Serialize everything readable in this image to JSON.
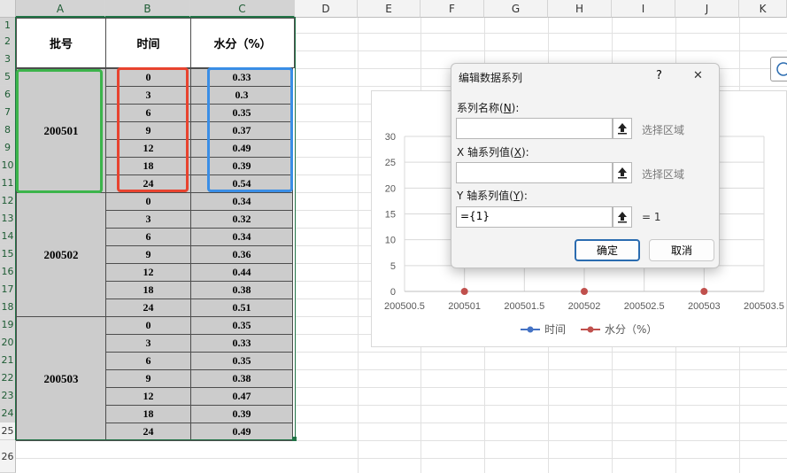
{
  "sheet": {
    "columns": [
      "A",
      "B",
      "C",
      "D",
      "E",
      "F",
      "G",
      "H",
      "I",
      "J",
      "K"
    ],
    "rows": [
      "1",
      "2",
      "3",
      "4",
      "5",
      "6",
      "7",
      "8",
      "9",
      "10",
      "11",
      "12",
      "13",
      "14",
      "15",
      "16",
      "17",
      "18",
      "19",
      "20",
      "21",
      "22",
      "23",
      "24",
      "25",
      "26"
    ]
  },
  "table": {
    "header": {
      "batch": "批号",
      "time": "时间",
      "moisture": "水分（%）"
    },
    "groups": [
      {
        "batch": "200501",
        "rows": [
          [
            "0",
            "0.33"
          ],
          [
            "3",
            "0.3"
          ],
          [
            "6",
            "0.35"
          ],
          [
            "9",
            "0.37"
          ],
          [
            "12",
            "0.49"
          ],
          [
            "18",
            "0.39"
          ],
          [
            "24",
            "0.54"
          ]
        ]
      },
      {
        "batch": "200502",
        "rows": [
          [
            "0",
            "0.34"
          ],
          [
            "3",
            "0.32"
          ],
          [
            "6",
            "0.34"
          ],
          [
            "9",
            "0.36"
          ],
          [
            "12",
            "0.44"
          ],
          [
            "18",
            "0.38"
          ],
          [
            "24",
            "0.51"
          ]
        ]
      },
      {
        "batch": "200503",
        "rows": [
          [
            "0",
            "0.35"
          ],
          [
            "3",
            "0.33"
          ],
          [
            "6",
            "0.35"
          ],
          [
            "9",
            "0.38"
          ],
          [
            "12",
            "0.47"
          ],
          [
            "18",
            "0.39"
          ],
          [
            "24",
            "0.49"
          ]
        ]
      }
    ]
  },
  "chart_data": {
    "type": "scatter",
    "x_ticks": [
      "200500.5",
      "200501",
      "200501.5",
      "200502",
      "200502.5",
      "200503",
      "200503.5"
    ],
    "y_ticks": [
      "0",
      "5",
      "10",
      "15",
      "20",
      "25",
      "30"
    ],
    "xlim": [
      200500.5,
      200503.5
    ],
    "ylim": [
      0,
      30
    ],
    "series": [
      {
        "name": "时间",
        "color": "#4472c4",
        "x": [],
        "y": []
      },
      {
        "name": "水分（%）",
        "color": "#c0504d",
        "x": [
          200501,
          200502,
          200503
        ],
        "y": [
          0,
          0,
          0
        ]
      }
    ],
    "legend_position": "bottom"
  },
  "dialog": {
    "title": "编辑数据系列",
    "help": "?",
    "close": "✕",
    "series_name_label": "系列名称(",
    "series_name_key": "N",
    "x_values_label": "X 轴系列值(",
    "x_values_key": "X",
    "y_values_label": "Y 轴系列值(",
    "y_values_key": "Y",
    "label_end": "):",
    "series_name_value": "",
    "x_values_value": "",
    "y_values_value": "={1}",
    "select_range": "选择区域",
    "y_result": "= 1",
    "ok": "确定",
    "cancel": "取消"
  },
  "colors": {
    "selection_green": "#217346",
    "highlight_green": "#3cb44b",
    "highlight_red": "#e8432f",
    "highlight_blue": "#3a8ee6",
    "table_grey": "#cccccc"
  }
}
